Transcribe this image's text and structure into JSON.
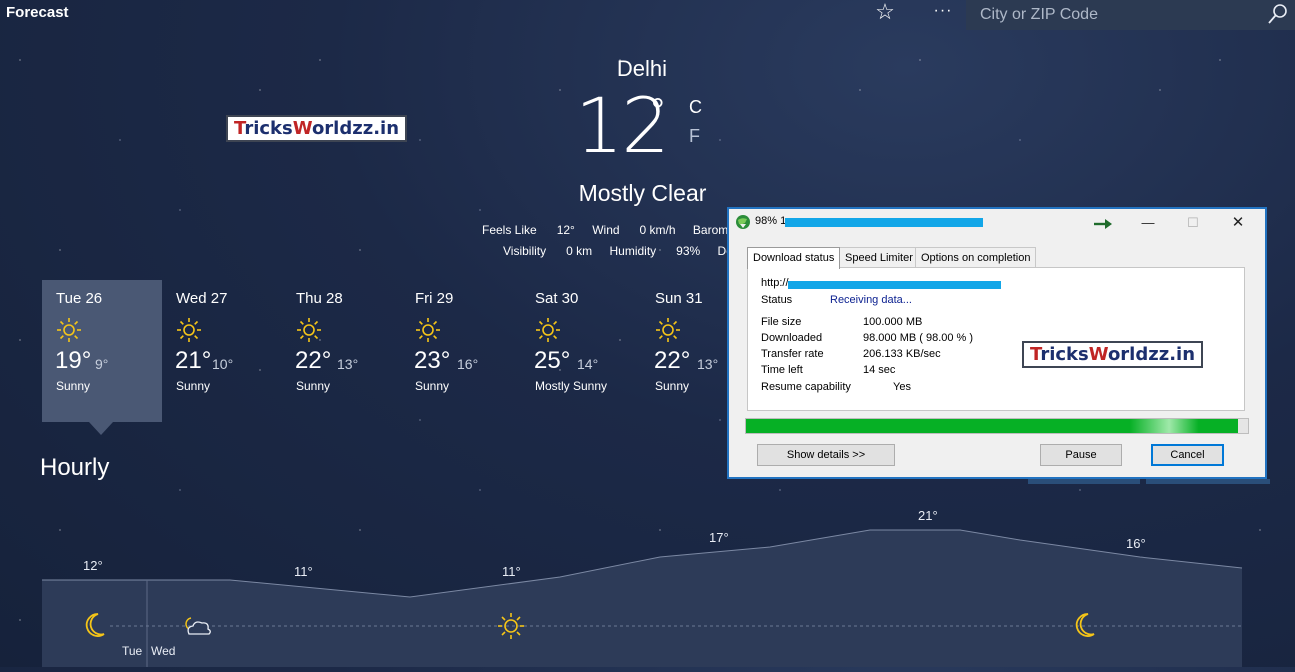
{
  "app": {
    "title": "Forecast"
  },
  "search": {
    "placeholder": "City or ZIP Code"
  },
  "current": {
    "city": "Delhi",
    "temp": "12",
    "degree": "°",
    "unit_c": "C",
    "unit_f": "F",
    "condition": "Mostly Clear",
    "feels_like_label": "Feels Like",
    "feels_like_value": "12°",
    "wind_label": "Wind",
    "wind_value": "0 km/h",
    "barometer_label": "Baromet",
    "visibility_label": "Visibility",
    "visibility_value": "0 km",
    "humidity_label": "Humidity",
    "humidity_value": "93%",
    "dew_label": "Dev"
  },
  "watermark": {
    "cap1": "T",
    "part1": "ricks",
    "cap2": "W",
    "part2": "orldzz.in"
  },
  "daily": [
    {
      "day": "Tue 26",
      "hi": "19°",
      "lo": "9°",
      "cond": "Sunny"
    },
    {
      "day": "Wed 27",
      "hi": "21°",
      "lo": "10°",
      "cond": "Sunny"
    },
    {
      "day": "Thu 28",
      "hi": "22°",
      "lo": "13°",
      "cond": "Sunny"
    },
    {
      "day": "Fri 29",
      "hi": "23°",
      "lo": "16°",
      "cond": "Sunny"
    },
    {
      "day": "Sat 30",
      "hi": "25°",
      "lo": "14°",
      "cond": "Mostly Sunny"
    },
    {
      "day": "Sun 31",
      "hi": "22°",
      "lo": "13°",
      "cond": "Sunny"
    }
  ],
  "hourly": {
    "title": "Hourly",
    "temps": [
      "12°",
      "11°",
      "11°",
      "17°",
      "21°",
      "16°"
    ],
    "day_labels": [
      "Tue",
      "Wed"
    ]
  },
  "download": {
    "title_prefix": "98% 1",
    "tabs": [
      "Download status",
      "Speed Limiter",
      "Options on completion"
    ],
    "url_prefix": "http://",
    "status_label": "Status",
    "status_value": "Receiving data...",
    "file_size_label": "File size",
    "file_size_value": "100.000  MB",
    "downloaded_label": "Downloaded",
    "downloaded_value": "98.000  MB  ( 98.00 % )",
    "transfer_label": "Transfer rate",
    "transfer_value": "206.133  KB/sec",
    "time_left_label": "Time left",
    "time_left_value": "14 sec",
    "resume_label": "Resume capability",
    "resume_value": "Yes",
    "progress_percent": 98,
    "show_details_label": "Show details >>",
    "pause_label": "Pause",
    "cancel_label": "Cancel",
    "minimize": "—",
    "maximize": "☐",
    "close": "✕"
  }
}
